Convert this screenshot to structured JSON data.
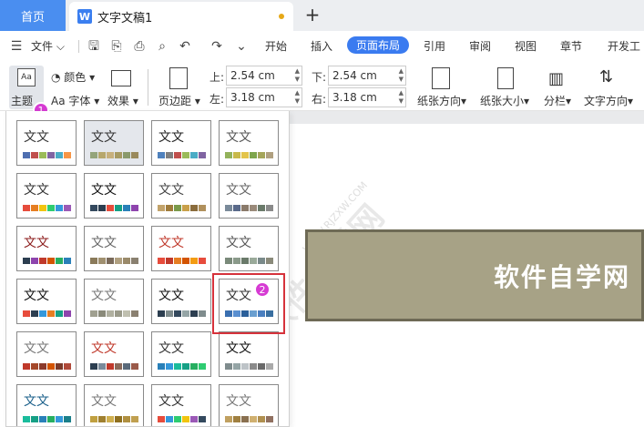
{
  "tabs": {
    "home": "首页",
    "doc_icon": "W",
    "doc_title": "文字文稿1",
    "add": "+"
  },
  "menu": {
    "file": "文件",
    "items": [
      "开始",
      "插入",
      "页面布局",
      "引用",
      "审阅",
      "视图",
      "章节",
      "开发工"
    ]
  },
  "ribbon": {
    "theme": "主题",
    "color": "颜色",
    "font": "Aa 字体",
    "effect": "效果",
    "margin": "页边距",
    "top_label": "上:",
    "top_value": "2.54 cm",
    "bottom_label": "下:",
    "bottom_value": "2.54 cm",
    "left_label": "左:",
    "left_value": "3.18 cm",
    "right_label": "右:",
    "right_value": "3.18 cm",
    "orientation": "纸张方向",
    "size": "纸张大小",
    "columns": "分栏",
    "direction": "文字方向",
    "theme_icon_text": "Aa"
  },
  "badges": {
    "one": "1",
    "two": "2"
  },
  "themes": {
    "sample_text": "文文",
    "tiles": [
      {
        "color": "#333333",
        "swatches": [
          "#4f6fb0",
          "#c0504d",
          "#9bbb59",
          "#8064a2",
          "#4bacc6",
          "#f79646"
        ]
      },
      {
        "color": "#333333",
        "swatches": [
          "#94a47a",
          "#b7a76c",
          "#c7b07c",
          "#a79a62",
          "#8a9a6c",
          "#9a8a5c"
        ],
        "highlight": true
      },
      {
        "color": "#222222",
        "swatches": [
          "#4f81bd",
          "#7f7f7f",
          "#c0504d",
          "#9bbb59",
          "#4bacc6",
          "#8064a2"
        ]
      },
      {
        "color": "#555555",
        "swatches": [
          "#93b25b",
          "#c8b94a",
          "#e3c44a",
          "#7ea54c",
          "#a5a55a",
          "#b0a080"
        ]
      },
      {
        "color": "#333333",
        "swatches": [
          "#e64c3c",
          "#e67e22",
          "#f1c40f",
          "#2ecc71",
          "#3498db",
          "#9b59b6"
        ]
      },
      {
        "color": "#111111",
        "swatches": [
          "#34495e",
          "#2c3e50",
          "#e74c3c",
          "#16a085",
          "#2980b9",
          "#8e44ad"
        ]
      },
      {
        "color": "#444444",
        "swatches": [
          "#c2a36b",
          "#a07c3c",
          "#7a9a4a",
          "#c9a04a",
          "#8a6c3c",
          "#b0905c"
        ]
      },
      {
        "color": "#666666",
        "swatches": [
          "#7a8a9a",
          "#5a6a8a",
          "#8a7a6a",
          "#9a8a7a",
          "#6a7a6a",
          "#8a8a8a"
        ]
      },
      {
        "color": "#8b1a1a",
        "swatches": [
          "#2c3e50",
          "#8e44ad",
          "#c0392b",
          "#d35400",
          "#27ae60",
          "#2980b9"
        ]
      },
      {
        "color": "#666666",
        "swatches": [
          "#8a7a5a",
          "#a09070",
          "#7a6a5a",
          "#b0a080",
          "#9a8a6a",
          "#8a8070"
        ]
      },
      {
        "color": "#c0392b",
        "swatches": [
          "#e74c3c",
          "#c0392b",
          "#e67e22",
          "#d35400",
          "#f39c12",
          "#e74c3c"
        ]
      },
      {
        "color": "#555555",
        "swatches": [
          "#7a8a7a",
          "#8a9a8a",
          "#6a7a6a",
          "#9aaa9a",
          "#7a8a8a",
          "#8a8a7a"
        ]
      },
      {
        "color": "#111111",
        "swatches": [
          "#e74c3c",
          "#2c3e50",
          "#3498db",
          "#e67e22",
          "#16a085",
          "#8e44ad"
        ]
      },
      {
        "color": "#777777",
        "swatches": [
          "#a0a090",
          "#8a8a7a",
          "#b0b0a0",
          "#9a9a8a",
          "#c0c0b0",
          "#8a8070"
        ]
      },
      {
        "color": "#111111",
        "swatches": [
          "#2c3e50",
          "#7f8c8d",
          "#34495e",
          "#95a5a6",
          "#2c3e50",
          "#7f8c8d"
        ]
      },
      {
        "color": "#333333",
        "swatches": [
          "#3a6fb0",
          "#5a8fd0",
          "#2a5f9a",
          "#6a9fd0",
          "#4a7fc0",
          "#3a6fa0"
        ]
      },
      {
        "color": "#777777",
        "swatches": [
          "#c0392b",
          "#a5492b",
          "#8b3a2b",
          "#d35400",
          "#7a3a2a",
          "#b04a3a"
        ]
      },
      {
        "color": "#c0392b",
        "swatches": [
          "#2c3e50",
          "#7a8a9a",
          "#c0392b",
          "#8a6a5a",
          "#5a6a7a",
          "#9a5a4a"
        ]
      },
      {
        "color": "#333333",
        "swatches": [
          "#2980b9",
          "#3498db",
          "#1abc9c",
          "#16a085",
          "#27ae60",
          "#2ecc71"
        ]
      },
      {
        "color": "#111111",
        "swatches": [
          "#7f8c8d",
          "#95a5a6",
          "#bdc3c7",
          "#8a8a8a",
          "#6a6a6a",
          "#aaaaaa"
        ]
      },
      {
        "color": "#1a5f8a",
        "swatches": [
          "#1abc9c",
          "#16a085",
          "#2980b9",
          "#27ae60",
          "#3498db",
          "#1a7f8a"
        ]
      },
      {
        "color": "#777777",
        "swatches": [
          "#c0a040",
          "#a08030",
          "#d0b050",
          "#907020",
          "#b09040",
          "#c0a050"
        ]
      },
      {
        "color": "#333333",
        "swatches": [
          "#e74c3c",
          "#3498db",
          "#2ecc71",
          "#f1c40f",
          "#9b59b6",
          "#34495e"
        ]
      },
      {
        "color": "#777777",
        "swatches": [
          "#c0a060",
          "#a08040",
          "#8a7050",
          "#d0b070",
          "#b09050",
          "#907060"
        ]
      }
    ]
  },
  "document": {
    "title": "软件自学网",
    "title_bg": "#a7a286",
    "watermark": "软件自学网",
    "watermark_url": "WWW.RJZXW.COM"
  },
  "colors": {
    "accent": "#3a7bf0",
    "home_tab": "#4a8ef0",
    "badge": "#d63bd3",
    "select_border": "#d6323b"
  }
}
